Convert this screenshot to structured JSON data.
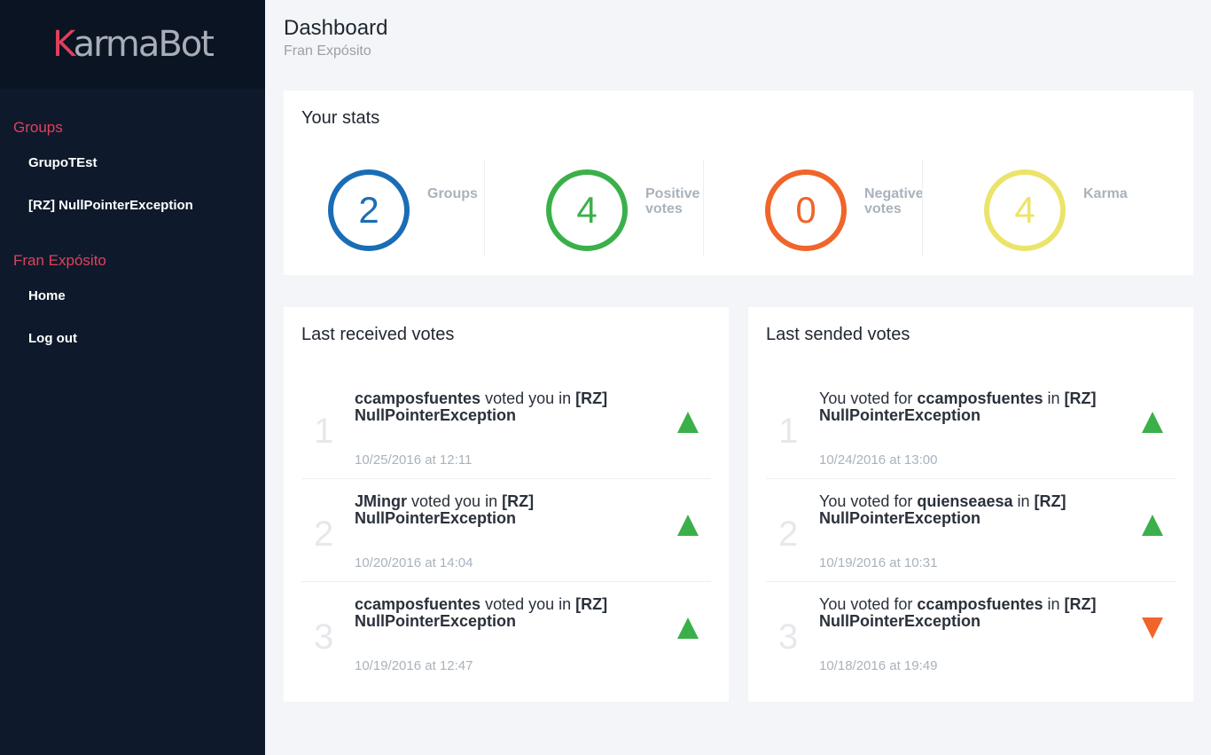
{
  "logo": {
    "first": "K",
    "rest": "armaBot"
  },
  "sidebar": {
    "groups_title": "Groups",
    "groups": [
      "GrupoTEst",
      "[RZ] NullPointerException"
    ],
    "user_title": "Fran Expósito",
    "user_items": [
      "Home",
      "Log out"
    ]
  },
  "header": {
    "title": "Dashboard",
    "subtitle": "Fran Expósito"
  },
  "stats": {
    "title": "Your stats",
    "items": [
      {
        "value": "2",
        "label": "Groups",
        "color": "#1a6db5"
      },
      {
        "value": "4",
        "label": "Positive votes",
        "color": "#3bb04a"
      },
      {
        "value": "0",
        "label": "Negative votes",
        "color": "#f0652a"
      },
      {
        "value": "4",
        "label": "Karma",
        "color": "#ece46a"
      }
    ]
  },
  "received": {
    "title": "Last received votes",
    "items": [
      {
        "num": "1",
        "user": "ccamposfuentes",
        "mid": " voted you in ",
        "group": "[RZ] NullPointerException",
        "date": "10/25/2016 at 12:11",
        "dir": "up"
      },
      {
        "num": "2",
        "user": "JMingr",
        "mid": " voted you in ",
        "group": "[RZ] NullPointerException",
        "date": "10/20/2016 at 14:04",
        "dir": "up"
      },
      {
        "num": "3",
        "user": "ccamposfuentes",
        "mid": " voted you in ",
        "group": "[RZ] NullPointerException",
        "date": "10/19/2016 at 12:47",
        "dir": "up"
      }
    ]
  },
  "sended": {
    "title": "Last sended votes",
    "items": [
      {
        "num": "1",
        "pre": "You voted for ",
        "user": "ccamposfuentes",
        "mid": " in ",
        "group": "[RZ] NullPointerException",
        "date": "10/24/2016 at 13:00",
        "dir": "up"
      },
      {
        "num": "2",
        "pre": "You voted for ",
        "user": "quienseaesa",
        "mid": " in ",
        "group": "[RZ] NullPointerException",
        "date": "10/19/2016 at 10:31",
        "dir": "up"
      },
      {
        "num": "3",
        "pre": "You voted for ",
        "user": "ccamposfuentes",
        "mid": " in ",
        "group": "[RZ] NullPointerException",
        "date": "10/18/2016 at 19:49",
        "dir": "down"
      }
    ]
  }
}
